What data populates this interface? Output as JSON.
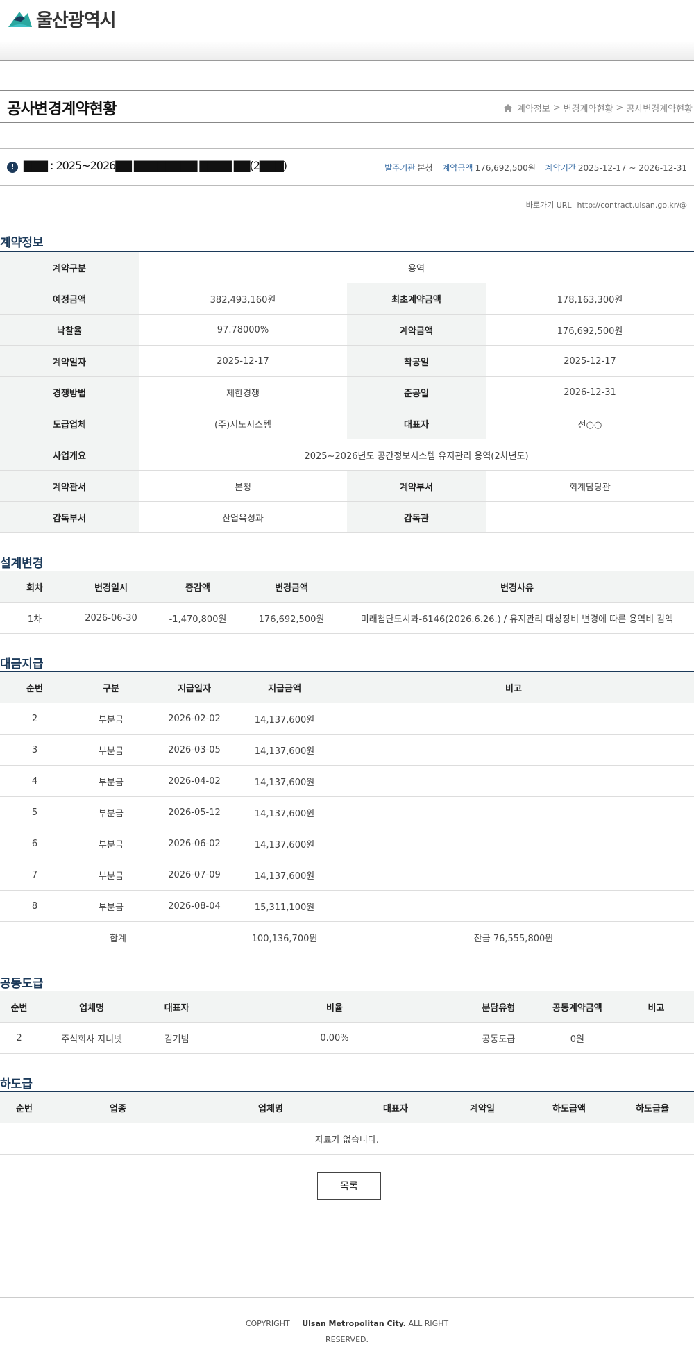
{
  "header": {
    "logo_text": "울산광역시"
  },
  "page_title": "공사변경계약현황",
  "breadcrumb": [
    "계약정보",
    "변경계약현황",
    "공사변경계약현황"
  ],
  "breadcrumb_sep": ">",
  "contract": {
    "name": "▇▇▇ : 2025~2026▇▇ ▇▇▇▇▇▇▇▇ ▇▇▇▇ ▇▇(2▇▇▇)",
    "agency_label": "발주기관",
    "agency": "본청",
    "amount_label": "계약금액",
    "amount": "176,692,500원",
    "period_label": "계약기간",
    "period": "2025-12-17 ~ 2026-12-31",
    "url_label": "바로가기 URL",
    "url": "http://contract.ulsan.go.kr/@"
  },
  "sections": {
    "info": "계약정보",
    "design": "설계변경",
    "payment": "대금지급",
    "joint": "공동도급",
    "subcontract": "하도급"
  },
  "info_rows": [
    {
      "k1": "계약구분",
      "v1": "용역"
    },
    {
      "k1": "예정금액",
      "v1": "382,493,160원",
      "k2": "최초계약금액",
      "v2": "178,163,300원"
    },
    {
      "k1": "낙찰율",
      "v1": "97.78000%",
      "k2": "계약금액",
      "v2": "176,692,500원"
    },
    {
      "k1": "계약일자",
      "v1": "2025-12-17",
      "k2": "착공일",
      "v2": "2025-12-17"
    },
    {
      "k1": "경쟁방법",
      "v1": "제한경쟁",
      "k2": "준공일",
      "v2": "2026-12-31"
    },
    {
      "k1": "도급업체",
      "v1": "(주)지노시스템",
      "k2": "대표자",
      "v2": "전○○"
    },
    {
      "k1": "사업개요",
      "v1": "2025~2026년도 공간정보시스템 유지관리 용역(2차년도)"
    },
    {
      "k1": "계약관서",
      "v1": "본청",
      "k2": "계약부서",
      "v2": "회계담당관"
    },
    {
      "k1": "감독부서",
      "v1": "산업육성과",
      "k2": "감독관",
      "v2": ""
    }
  ],
  "design": {
    "headers": [
      "회차",
      "변경일시",
      "증감액",
      "변경금액",
      "변경사유"
    ],
    "rows": [
      [
        "1차",
        "2026-06-30",
        "-1,470,800원",
        "176,692,500원",
        "미래첨단도시과-6146(2026.6.26.) / 유지관리 대상장비 변경에 따른 용역비 감액"
      ]
    ]
  },
  "payment": {
    "headers": [
      "순번",
      "구분",
      "지급일자",
      "지급금액",
      "비고"
    ],
    "rows": [
      [
        "2",
        "부분금",
        "2026-02-02",
        "14,137,600원",
        ""
      ],
      [
        "3",
        "부분금",
        "2026-03-05",
        "14,137,600원",
        ""
      ],
      [
        "4",
        "부분금",
        "2026-04-02",
        "14,137,600원",
        ""
      ],
      [
        "5",
        "부분금",
        "2026-05-12",
        "14,137,600원",
        ""
      ],
      [
        "6",
        "부분금",
        "2026-06-02",
        "14,137,600원",
        ""
      ],
      [
        "7",
        "부분금",
        "2026-07-09",
        "14,137,600원",
        ""
      ],
      [
        "8",
        "부분금",
        "2026-08-04",
        "15,311,100원",
        ""
      ]
    ],
    "total_label": "합계",
    "total": "100,136,700원",
    "balance": "잔금 76,555,800원"
  },
  "joint": {
    "headers": [
      "순번",
      "업체명",
      "대표자",
      "비율",
      "분담유형",
      "공동계약금액",
      "비고"
    ],
    "rows": [
      [
        "2",
        "주식회사 지니넷",
        "김기범",
        "0.00%",
        "공동도급",
        "0원",
        ""
      ]
    ]
  },
  "subcontract": {
    "headers": [
      "순번",
      "업종",
      "업체명",
      "대표자",
      "계약일",
      "하도급액",
      "하도급율"
    ],
    "empty": "자료가 없습니다."
  },
  "list_button": "목록",
  "footer": {
    "copyright": "COPYRIGHT",
    "org": "Ulsan Metropolitan City.",
    "rights1": "ALL RIGHT",
    "rights2": "RESERVED."
  }
}
